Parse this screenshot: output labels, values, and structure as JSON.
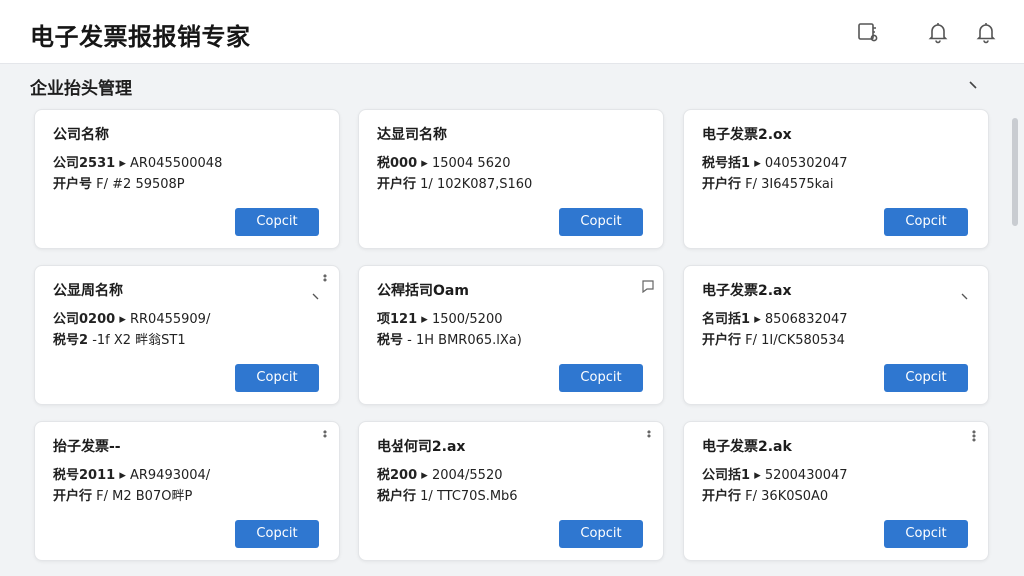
{
  "app": {
    "title": "电子发票报报销专家"
  },
  "section": {
    "title": "企业抬头管理"
  },
  "cards": [
    {
      "title": "公司名称",
      "l1k": "公司2531",
      "l1v": "▸  AR045500048",
      "l2k": "开户号",
      "l2v": "F/  #2 59508P",
      "button": "Copcit"
    },
    {
      "title": "达显司名称",
      "l1k": "税000",
      "l1v": "▸  15004 5620",
      "l2k": "开户行",
      "l2v": "1/  102K087,S160",
      "button": "Copcit"
    },
    {
      "title": "电子发票2.ox",
      "l1k": "税号括1",
      "l1v": "▸  0405302047",
      "l2k": "开户行",
      "l2v": "F/  3I64575kai",
      "button": "Copcit"
    },
    {
      "title": "公显周名称",
      "l1k": "公司0200",
      "l1v": "▸  RR0455909/",
      "l2k": "税号2",
      "l2v": "-1f  X2 畔翁ST1",
      "button": "Copcit"
    },
    {
      "title": "公稈括司Oam",
      "l1k": "项121",
      "l1v": "▸  1500/5200",
      "l2k": "税号",
      "l2v": "-  1H  BMR065.lXa)",
      "button": "Copcit"
    },
    {
      "title": "电子发票2.ax",
      "l1k": "名司括1",
      "l1v": "▸  8506832047",
      "l2k": "开户行",
      "l2v": "F/  1I/CK580534",
      "button": "Copcit"
    },
    {
      "title": "抬子发票--",
      "l1k": "税号2011",
      "l1v": "▸  AR9493004/",
      "l2k": "开户行",
      "l2v": "F/  M2 B07O畔P",
      "button": "Copcit"
    },
    {
      "title": "电셮何司2.ax",
      "l1k": "税200",
      "l1v": "▸  2004/5520",
      "l2k": "税户行",
      "l2v": "1/  TTC70S.Mb6",
      "button": "Copcit"
    },
    {
      "title": "电子发票2.ak",
      "l1k": "公司括1",
      "l1v": "▸  5200430047",
      "l2k": "开户行",
      "l2v": "F/  36K0S0A0",
      "button": "Copcit"
    }
  ]
}
